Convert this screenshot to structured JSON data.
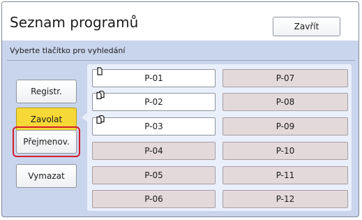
{
  "header": {
    "title": "Seznam programů",
    "close_label": "Zavřít"
  },
  "hint": "Vyberte tlačítko pro vyhledání",
  "side_buttons": [
    {
      "label": "Registr."
    },
    {
      "label": "Zavolat",
      "state": "active"
    },
    {
      "label": "Přejmenov.",
      "state": "highlighted"
    },
    {
      "label": "Vymazat"
    }
  ],
  "programs": [
    {
      "label": "P-01",
      "icon": "single-page-icon"
    },
    {
      "label": "P-02",
      "icon": "multi-page-icon"
    },
    {
      "label": "P-03",
      "icon": "multi-page-icon"
    },
    {
      "label": "P-04"
    },
    {
      "label": "P-05"
    },
    {
      "label": "P-06"
    },
    {
      "label": "P-07"
    },
    {
      "label": "P-08"
    },
    {
      "label": "P-09"
    },
    {
      "label": "P-10"
    },
    {
      "label": "P-11"
    },
    {
      "label": "P-12"
    }
  ],
  "colors": {
    "panel_bg": "#c9d5ec",
    "active_button": "#f6d937",
    "highlight_outline": "#d51c2c",
    "empty_slot": "#e3d9db"
  }
}
